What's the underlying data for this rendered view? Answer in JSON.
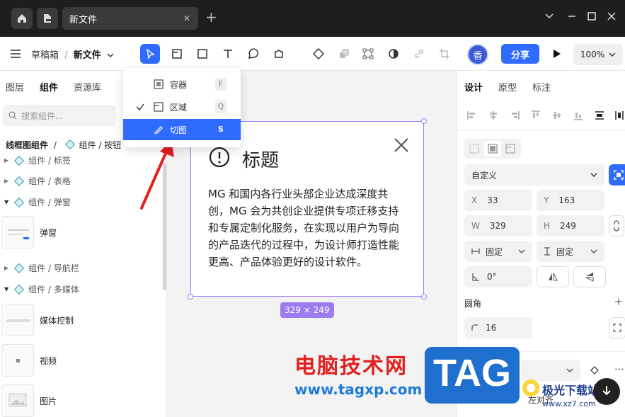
{
  "titlebar": {
    "tab_title": "新文件",
    "close": "✕",
    "new_tab": "+"
  },
  "toolbar": {
    "menu_icon": "hamburger-icon",
    "breadcrumb_parent": "草稿箱",
    "breadcrumb_sep": "/",
    "breadcrumb_current": "新文件",
    "avatar_text": "香",
    "share_label": "分享",
    "zoom_label": "100%"
  },
  "dropdown": {
    "items": [
      {
        "label": "容器",
        "key": "F",
        "checked": false,
        "selected": false
      },
      {
        "label": "区域",
        "key": "Q",
        "checked": true,
        "selected": false
      },
      {
        "label": "切图",
        "key": "S",
        "checked": false,
        "selected": true
      }
    ]
  },
  "left_panel": {
    "tabs": [
      "图层",
      "组件",
      "资源库"
    ],
    "active_tab": "组件",
    "search_placeholder": "搜索组件...",
    "breadcrumb_root": "线框图组件",
    "breadcrumb_sep": "/",
    "breadcrumb_leaf": "组件 / 按钮",
    "groups": [
      {
        "label": "组件 / 标签",
        "expanded": false
      },
      {
        "label": "组件 / 表格",
        "expanded": false
      },
      {
        "label": "组件 / 弹窗",
        "expanded": true
      },
      {
        "label": "组件 / 导航栏",
        "expanded": false
      },
      {
        "label": "组件 / 多媒体",
        "expanded": true
      }
    ],
    "components": [
      "弹窗",
      "媒体控制",
      "视频",
      "图片"
    ]
  },
  "canvas": {
    "dialog_title": "标题",
    "dialog_body": "MG 和国内各行业头部企业达成深度共创，MG 会为共创企业提供专项迁移支持和专属定制化服务，在实现以用户为导向的产品迭代的过程中，为设计师打造性能更高、产品体验更好的设计软件。",
    "dimension_label": "329 × 249"
  },
  "right_panel": {
    "tabs": [
      "设计",
      "原型",
      "标注"
    ],
    "active_tab": "设计",
    "size_preset": "自定义",
    "x_label": "X",
    "x_value": "33",
    "y_label": "Y",
    "y_value": "163",
    "w_label": "W",
    "w_value": "329",
    "h_label": "H",
    "h_value": "249",
    "width_mode": "固定",
    "height_mode": "固定",
    "rotation": "0°",
    "corner_label": "圆角",
    "corner_value": "16",
    "align_label": "左对齐"
  },
  "watermark": {
    "site_name": "电脑技术网",
    "site_url": "www.tagxp.com",
    "tag": "TAG",
    "brand2": "极光下载站",
    "brand2_url": "www.xz7.com"
  },
  "colors": {
    "accent": "#2f6bff",
    "selection": "#9c7cf0",
    "titlebar_bg": "#1e1e1e",
    "watermark_red": "#e02020",
    "watermark_blue": "#1f7bd8"
  }
}
